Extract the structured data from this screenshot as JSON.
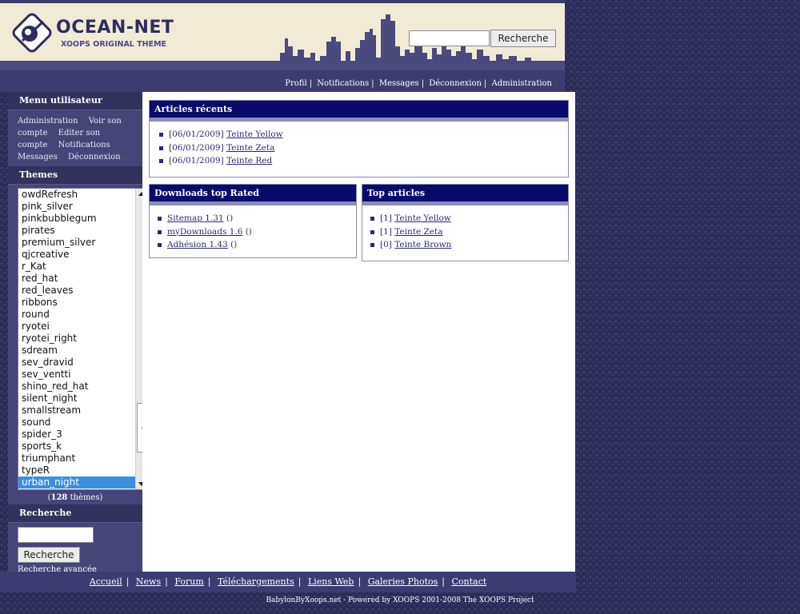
{
  "header": {
    "logo_title": "OCEAN-NET",
    "logo_subtitle": "XOOPS ORIGINAL THEME",
    "search_button": "Recherche",
    "search_value": "",
    "links": [
      "Profil",
      "Notifications",
      "Messages",
      "Déconnexion",
      "Administration"
    ]
  },
  "user_menu": {
    "title": "Menu utilisateur",
    "items": [
      "Administration",
      "Voir son compte",
      "Editer son compte",
      "Notifications",
      "Messages",
      "Déconnexion"
    ]
  },
  "themes": {
    "title": "Themes",
    "items": [
      "owdRefresh",
      "pink_silver",
      "pinkbubblegum",
      "pirates",
      "premium_silver",
      "qjcreative",
      "r_Kat",
      "red_hat",
      "red_leaves",
      "ribbons",
      "round",
      "ryotei",
      "ryotei_right",
      "sdream",
      "sev_dravid",
      "sev_ventti",
      "shino_red_hat",
      "silent_night",
      "smallstream",
      "sound",
      "spider_3",
      "sports_k",
      "triumphant",
      "typeR",
      "urban_night"
    ],
    "selected": "urban_night",
    "count_number": "128",
    "count_suffix": " thèmes",
    "count_open": "(",
    "count_close": ")"
  },
  "left_search": {
    "title": "Recherche",
    "value": "",
    "button": "Recherche",
    "advanced": "Recherche avancée"
  },
  "recent_articles": {
    "title": "Articles récents",
    "items": [
      {
        "date": "[06/01/2009]",
        "label": "Teinte Yellow"
      },
      {
        "date": "[06/01/2009]",
        "label": "Teinte Zeta"
      },
      {
        "date": "[06/01/2009]",
        "label": "Teinte Red"
      }
    ]
  },
  "downloads": {
    "title": "Downloads top Rated",
    "items": [
      {
        "label": "Sitemap 1.31",
        "suffix": " ()"
      },
      {
        "label": "myDownloads 1.6",
        "suffix": " ()"
      },
      {
        "label": "Adhésion 1.43",
        "suffix": " ()"
      }
    ]
  },
  "top_articles": {
    "title": "Top articles",
    "items": [
      {
        "count": "[1]",
        "label": "Teinte Yellow"
      },
      {
        "count": "[1]",
        "label": "Teinte Zeta"
      },
      {
        "count": "[0]",
        "label": "Teinte Brown"
      }
    ]
  },
  "footer": {
    "links": [
      "Accueil",
      "News",
      "Forum",
      "Téléchargements",
      "Liens Web",
      "Galeries Photos",
      "Contact"
    ],
    "powered": "BabylonByXoops.net - Powered by XOOPS 2001-2008 The XOOPS Project"
  },
  "colors": {
    "page_bg": "#2c2c58",
    "header_band": "#f1ead6",
    "nav_bar": "#3c3c72",
    "block_title_bg": "#0a0a6a",
    "selected_theme": "#3b8fe0"
  }
}
